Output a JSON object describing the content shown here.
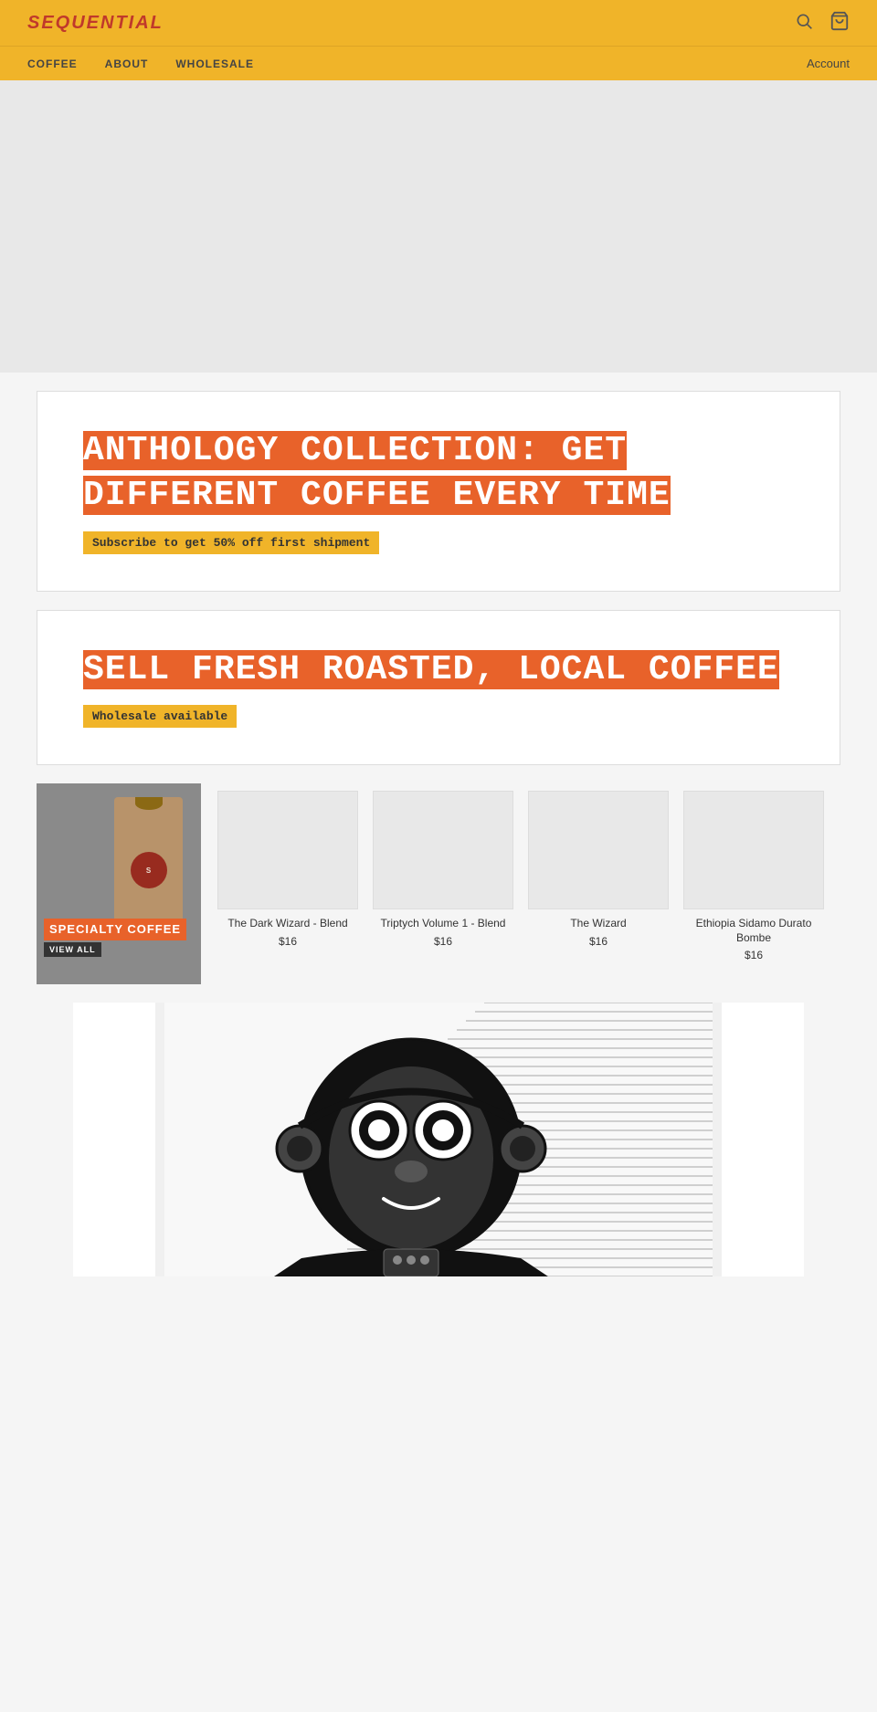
{
  "header": {
    "logo": "SEQUENTIAL",
    "nav_items": [
      {
        "label": "COFFEE",
        "href": "#"
      },
      {
        "label": "ABOUT",
        "href": "#"
      },
      {
        "label": "WHOLESALE",
        "href": "#"
      }
    ],
    "account_label": "Account",
    "search_icon": "🔍",
    "cart_icon": "🛒"
  },
  "banners": [
    {
      "title": "ANTHOLOGY COLLECTION: GET DIFFERENT COFFEE EVERY TIME",
      "subtitle": "Subscribe to get 50% off first shipment"
    },
    {
      "title": "SELL FRESH ROASTED, LOCAL COFFEE",
      "subtitle": "Wholesale available"
    }
  ],
  "featured_section": {
    "label": "SPECIALTY COFFEE",
    "view_all": "VIEW ALL"
  },
  "products": [
    {
      "name": "The Dark Wizard - Blend",
      "price": "$16"
    },
    {
      "name": "Triptych Volume 1 - Blend",
      "price": "$16"
    },
    {
      "name": "The Wizard",
      "price": "$16"
    },
    {
      "name": "Ethiopia Sidamo Durato Bombe",
      "price": "$16"
    }
  ]
}
